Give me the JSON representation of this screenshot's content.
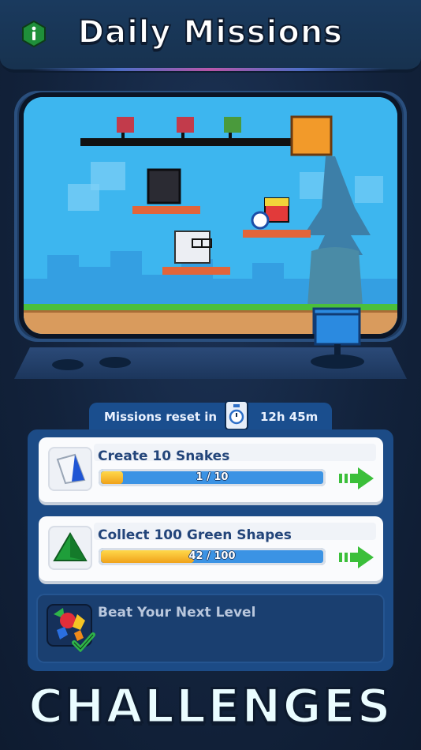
{
  "header": {
    "title": "Daily Missions",
    "info_icon": "info-icon",
    "accent_color": "#1f8f3a"
  },
  "reset": {
    "label": "Missions reset in",
    "time": "12h 45m",
    "icon": "stopwatch-icon"
  },
  "missions": [
    {
      "title": "Create 10 Snakes",
      "icon": "white-blue-block-icon",
      "progress_text": "1 / 10",
      "progress": 0.1,
      "action_icon": "green-arrow-icon"
    },
    {
      "title": "Collect 100 Green Shapes",
      "icon": "green-triangle-icon",
      "progress_text": "42 / 100",
      "progress": 0.42,
      "action_icon": "green-arrow-icon"
    },
    {
      "title": "Beat Your Next Level",
      "icon": "colored-shapes-checkmark-icon",
      "status": "completed"
    }
  ],
  "footer": {
    "title": "CHALLENGES"
  },
  "colors": {
    "background": "#13233d",
    "panel": "#1c4b86",
    "progress_track": "#3b93e4",
    "progress_fill": "#f0a21a",
    "arrow": "#3bbf3a"
  }
}
